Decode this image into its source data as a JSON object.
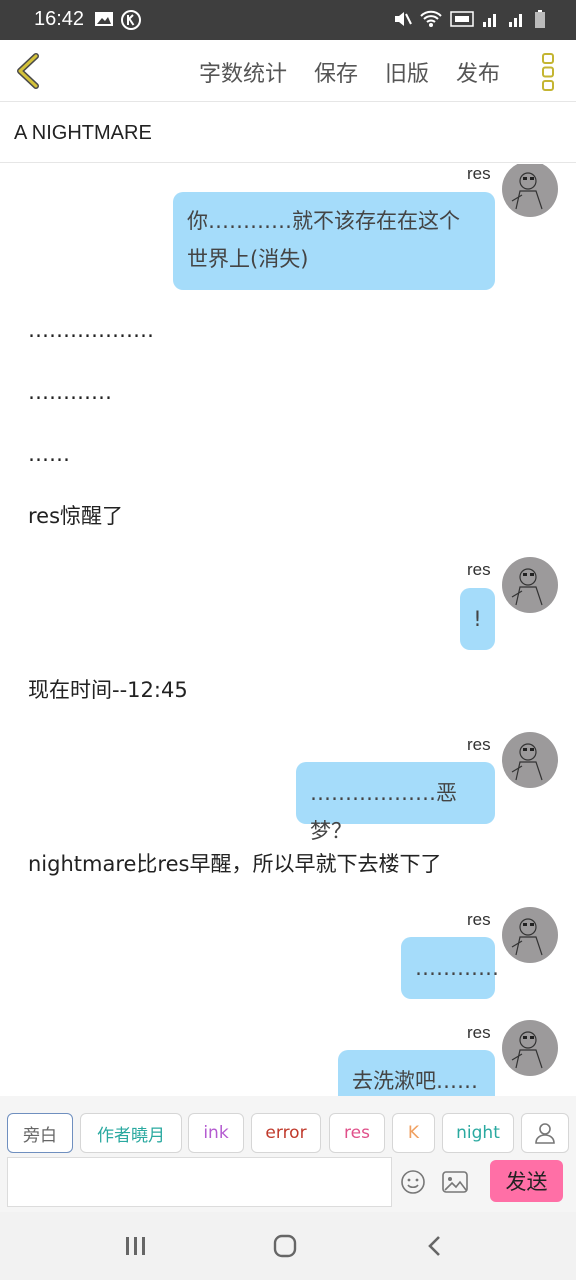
{
  "status": {
    "time": "16:42"
  },
  "toolbar": {
    "actions": [
      "字数统计",
      "保存",
      "旧版",
      "发布"
    ],
    "accent": "#d4c23a"
  },
  "title": "A NIGHTMARE",
  "chat": {
    "speaker": "res",
    "messages": [
      {
        "type": "bubble",
        "speaker": "res",
        "lines": [
          "你…………就不该存在在这个",
          "世界上(消失)"
        ]
      },
      {
        "type": "narration",
        "text": "………………"
      },
      {
        "type": "narration",
        "text": "…………"
      },
      {
        "type": "narration",
        "text": "……"
      },
      {
        "type": "narration",
        "text": "res惊醒了"
      },
      {
        "type": "bubble",
        "speaker": "res",
        "lines": [
          "!"
        ]
      },
      {
        "type": "narration",
        "text": "现在时间--12:45"
      },
      {
        "type": "bubble",
        "speaker": "res",
        "lines": [
          "………………恶梦？"
        ]
      },
      {
        "type": "narration",
        "text": "nightmare比res早醒，所以早就下去楼下了"
      },
      {
        "type": "bubble",
        "speaker": "res",
        "lines": [
          "…………"
        ]
      },
      {
        "type": "bubble",
        "speaker": "res",
        "lines": [
          "去洗漱吧……"
        ]
      }
    ]
  },
  "roles": [
    {
      "label": "旁白",
      "color": "#666666"
    },
    {
      "label": "作者曉月",
      "color": "#2aa9a0"
    },
    {
      "label": "ink",
      "color": "#b45bd0"
    },
    {
      "label": "error",
      "color": "#c0392b"
    },
    {
      "label": "res",
      "color": "#e0508a"
    },
    {
      "label": "K",
      "color": "#f0a060"
    },
    {
      "label": "night",
      "color": "#2aa9a0"
    }
  ],
  "input": {
    "placeholder": ""
  },
  "send_label": "发送",
  "colors": {
    "bubble": "#a5dcfa",
    "send": "#ff6fa6"
  }
}
